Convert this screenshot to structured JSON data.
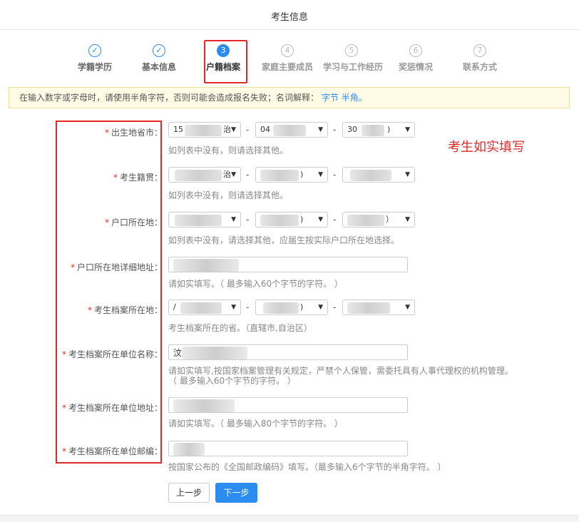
{
  "header": {
    "title": "考生信息"
  },
  "steps": [
    {
      "number": "✓",
      "label": "学籍学历",
      "state": "done"
    },
    {
      "number": "✓",
      "label": "基本信息",
      "state": "done"
    },
    {
      "number": "3",
      "label": "户籍档案",
      "state": "active"
    },
    {
      "number": "4",
      "label": "家庭主要成员",
      "state": "todo"
    },
    {
      "number": "5",
      "label": "学习与工作经历",
      "state": "todo"
    },
    {
      "number": "6",
      "label": "奖惩情况",
      "state": "todo"
    },
    {
      "number": "7",
      "label": "联系方式",
      "state": "todo"
    }
  ],
  "notice": {
    "text": "在输入数字或字母时，请使用半角字符，否则可能会造成报名失败；名词解释：",
    "link1": "字节",
    "link2": "半角。"
  },
  "annotation": "考生如实填写",
  "required_mark": "*",
  "separator": "-",
  "fields": {
    "birthplace": {
      "label": "出生地省市：",
      "select1": "15",
      "select1_suffix": "治",
      "select2": "04",
      "select3": "30",
      "select3_suffix": ")",
      "help": "如列表中没有，则请选择其他。"
    },
    "native_place": {
      "label": "考生籍贯：",
      "select1_suffix": "治",
      "select2_suffix": ")",
      "help": "如列表中没有，则请选择其他。"
    },
    "hukou": {
      "label": "户口所在地：",
      "select2_suffix": ")",
      "select3_suffix": "）",
      "help": "如列表中没有，请选择其他，应届生按实际户口所在地选择。"
    },
    "hukou_address": {
      "label": "户口所在地详细地址：",
      "help": "请如实填写。（ 最多输入60个字节的字符。 ）"
    },
    "archive_place": {
      "label": "考生档案所在地：",
      "select1": "/",
      "select2_suffix": ")",
      "help": "考生档案所在的省。（直辖市,自治区）"
    },
    "archive_unit_name": {
      "label": "考生档案所在单位名称：",
      "value_prefix": "汶",
      "help_line1": "请如实填写,按国家档案管理有关规定，严禁个人保管，需委托具有人事代理权的机构管理。",
      "help_line2": "（ 最多输入60个字节的字符。 ）"
    },
    "archive_unit_address": {
      "label": "考生档案所在单位地址：",
      "help": "请如实填写。（ 最多输入80个字节的字符。 ）"
    },
    "archive_unit_zip": {
      "label": "考生档案所在单位邮编：",
      "help": "按国家公布的《全国邮政编码》填写。（最多输入6个字节的半角字符。 ）"
    }
  },
  "buttons": {
    "prev": "上一步",
    "next": "下一步"
  },
  "colors": {
    "accent": "#2d8cf0",
    "highlight": "#e02a2a",
    "notice_bg": "#fffbe5"
  }
}
